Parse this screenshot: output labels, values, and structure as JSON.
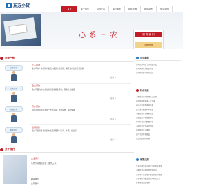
{
  "brand": {
    "name_cn": "东方小贷",
    "name_en": "DF Micro-loan"
  },
  "nav": [
    {
      "label": "首页",
      "active": true
    },
    {
      "label": "关于我们",
      "active": false
    },
    {
      "label": "贷款产品",
      "active": false
    },
    {
      "label": "客户服务",
      "active": false
    },
    {
      "label": "网点查询",
      "active": false
    },
    {
      "label": "新闻动态",
      "active": false
    },
    {
      "label": "常见问题",
      "active": false
    }
  ],
  "banner": {
    "slogan": "心 系 三 农",
    "card_tab": "服 务 我 们",
    "card_button": "公司地址"
  },
  "products": {
    "title": "贷款产品",
    "items": [
      {
        "bubble": "业务咨询",
        "title": "个人贷款",
        "desc": "我公司向个体经营户和农户提供小额贷款，满足客户日常经营需求",
        "more": "更多 >"
      },
      {
        "bubble": "业务咨询",
        "title": "企业贷款",
        "desc": "我公司面向中小企业提供流动资金贷款，帮助企业发展",
        "more": "更多 >"
      },
      {
        "bubble": "欢迎咨询",
        "title": "农户贷款",
        "desc": "面向农户提供农业生产经营贷款，手续简便，审批快捷",
        "more": "更多 >"
      },
      {
        "bubble": "联系我们",
        "title": "担保贷款",
        "desc": "我公司提供多种担保方式贷款服务（房产、车辆、保证等）",
        "more": "更多 >"
      }
    ]
  },
  "about": {
    "title": "关于我们",
    "line1": "企业简介",
    "line2": "东方小贷诚信经营，服务三农",
    "label1": "联系我们",
    "label2": "公司简介"
  },
  "side": {
    "news": {
      "title": "企业新闻",
      "items": [
        "公司召开年度工作总结大会",
        "公司举办业务知识培训",
        "公司开展客户回访活动"
      ]
    },
    "biz": {
      "title": "行业动态",
      "items": [
        "小额贷款公司管理办法出台",
        "农村金融服务进一步完善",
        "中小企业融资环境改善",
        "央行发布最新利率政策",
        "小额贷款行业健康发展",
        "金融支持三农政策解读",
        "各地小贷公司数量增长",
        "小微企业信贷支持加强",
        "普惠金融深入推进",
        "农户信用体系建设",
        "信贷风险防控措施"
      ]
    },
    "policy": {
      "title": "政策法规",
      "items": [
        "关于小额贷款公司试点的指导意见",
        "小额贷款公司监督管理办法",
        "关于进一步加强小额贷款公司管理",
        "关于做好小额贷款公司相关工作",
        "普惠金融发展规划",
        "关于支持农村金融发展的意见"
      ]
    }
  }
}
